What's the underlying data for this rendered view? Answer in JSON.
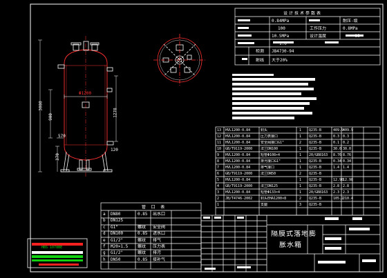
{
  "tech_table": {
    "header": "设计技术参数表",
    "rows": [
      {
        "c1": "0.84MPa",
        "c2": "",
        "c3": "耐压-级"
      },
      {
        "c1": "100",
        "c2": "工作压力",
        "c3": "0.8MPa"
      },
      {
        "c1": "10.5MPa",
        "c2": "设计温度",
        "c3": "-35"
      },
      {
        "c1": "1.0",
        "c2": "",
        "c3": ""
      },
      {
        "c1": "JB4730-94",
        "c2": "",
        "c3": ""
      },
      {
        "c1": "大于20%",
        "c2": "",
        "c3": ""
      }
    ],
    "row_labels": [
      "",
      "",
      "",
      "",
      "检测",
      "射线"
    ]
  },
  "parts_list": [
    {
      "no": "13",
      "code": "HVL1200-0.84",
      "name": "封头",
      "qty": "1",
      "mat": "Q235-B",
      "w1": "409.9",
      "w2": "409.9"
    },
    {
      "no": "12",
      "code": "HVL1200-0.84",
      "name": "压力表接口",
      "qty": "1",
      "mat": "Q235-B",
      "w1": "0.3",
      "w2": "0.3"
    },
    {
      "no": "11",
      "code": "HVL1200-0.84",
      "name": "安全阀接口G1\"",
      "qty": "2",
      "mat": "Q235-B",
      "w1": "0.1",
      "w2": "0.2"
    },
    {
      "no": "10",
      "code": "GB/T9119-2000",
      "name": "法兰DN100",
      "qty": "1",
      "mat": "Q235-B",
      "w1": "30.0",
      "w2": "30.0"
    },
    {
      "no": "9",
      "code": "HVL1200-0.84",
      "name": "短管Φ108×4",
      "qty": "1",
      "mat": "20/GB8163",
      "w1": "8.76",
      "w2": "8.76"
    },
    {
      "no": "8",
      "code": "HVL1200-0.84",
      "name": "排污接口G1\"",
      "qty": "1",
      "mat": "Q235-B",
      "w1": "0.34",
      "w2": "0.34"
    },
    {
      "no": "7",
      "code": "HVL1200-0.84",
      "name": "排气接口",
      "qty": "1",
      "mat": "Q235-B",
      "w1": "1.4",
      "w2": "1.4"
    },
    {
      "no": "6",
      "code": "GB/T9119-2000",
      "name": "法兰DN50",
      "qty": "2",
      "mat": "Q235-B",
      "w1": "",
      "w2": ""
    },
    {
      "no": "5",
      "code": "HVL1200-0.84",
      "name": "",
      "qty": "1",
      "mat": "Q235-B",
      "w1": "12.98",
      "w2": "12.98"
    },
    {
      "no": "4",
      "code": "GB/T9119-2000",
      "name": "法兰DN125",
      "qty": "1",
      "mat": "Q235-B",
      "w1": "2.8",
      "w2": "2.8"
    },
    {
      "no": "3",
      "code": "HVL1200-0.84",
      "name": "短管Φ133×4",
      "qty": "1",
      "mat": "20/GB8163",
      "w1": "2.3",
      "w2": "2.3"
    },
    {
      "no": "2",
      "code": "JB/T4746-2002",
      "name": "封头EHA1200×8",
      "qty": "2",
      "mat": "Q235-B",
      "w1": "105.2",
      "w2": "210.4"
    },
    {
      "no": "1",
      "code": "",
      "name": "支腿",
      "qty": "3",
      "mat": "Q235-B",
      "w1": "",
      "w2": ""
    }
  ],
  "nozzle_table": {
    "header": "管 口 表",
    "rows": [
      {
        "id": "a",
        "size": "DN80",
        "pn": "0.85",
        "use": "出水口",
        "conn": ""
      },
      {
        "id": "b",
        "size": "DN125",
        "pn": "",
        "use": "",
        "conn": ""
      },
      {
        "id": "c",
        "size": "G1\"",
        "pn": "螺纹",
        "use": "安全阀",
        "conn": ""
      },
      {
        "id": "d",
        "size": "DN100",
        "pn": "0.85",
        "use": "进水口",
        "conn": ""
      },
      {
        "id": "e",
        "size": "G1/2\"",
        "pn": "螺纹",
        "use": "排气",
        "conn": ""
      },
      {
        "id": "f",
        "size": "M20×1.5",
        "pn": "螺纹",
        "use": "压力表",
        "conn": ""
      },
      {
        "id": "g",
        "size": "G1/2\"",
        "pn": "螺纹",
        "use": "排污",
        "conn": ""
      },
      {
        "id": "h",
        "size": "DN50",
        "pn": "0.85",
        "use": "接补气",
        "conn": ""
      }
    ]
  },
  "title_block": {
    "title_line1": "隔膜式落地膨",
    "title_line2": "胀水箱",
    "stamp_text": "HBS 1078BE"
  },
  "drawing": {
    "dims": {
      "diameter": "Φ1200",
      "total_height": "3080",
      "h1": "1270",
      "h2": "900",
      "h3": "370",
      "h4": "570",
      "h5": "120"
    }
  },
  "colors": {
    "background": "#000000",
    "cad_line": "#ffffff",
    "vessel": "#ff3030",
    "centerline": "#ff3030"
  }
}
